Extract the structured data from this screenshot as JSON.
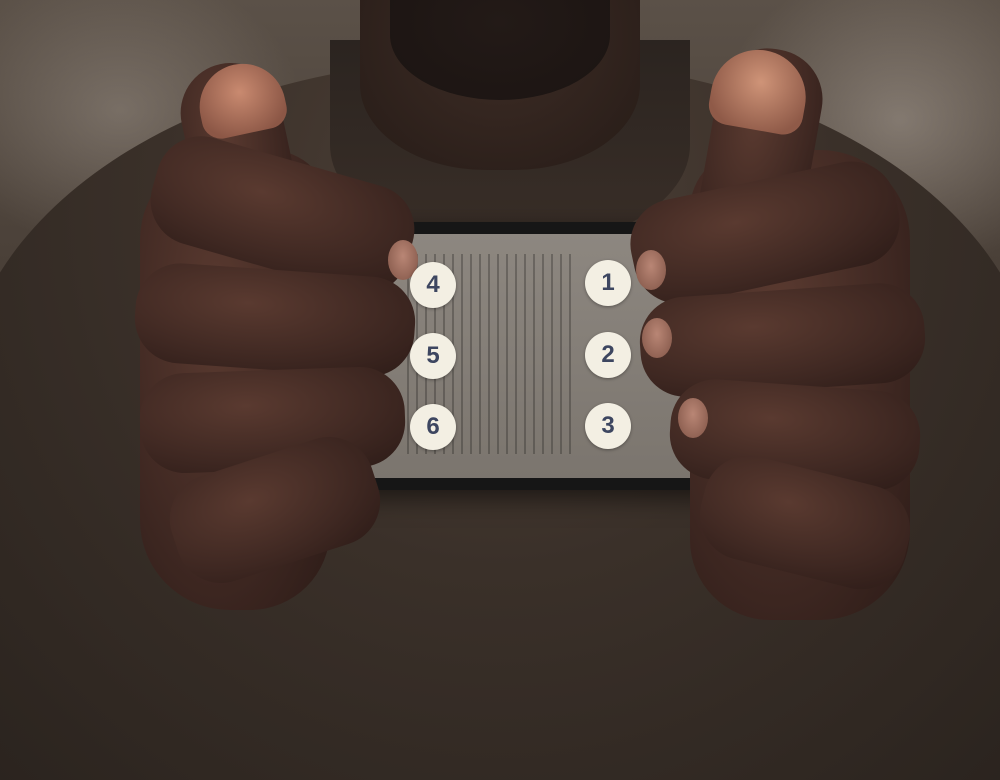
{
  "braille_dots": {
    "dot_1": "1",
    "dot_2": "2",
    "dot_3": "3",
    "dot_4": "4",
    "dot_5": "5",
    "dot_6": "6"
  },
  "colors": {
    "badge_fill": "#f3efe3",
    "badge_text": "#3d4660",
    "skin": "#3f2822",
    "shirt": "#3a3029",
    "phone": "#161616"
  }
}
